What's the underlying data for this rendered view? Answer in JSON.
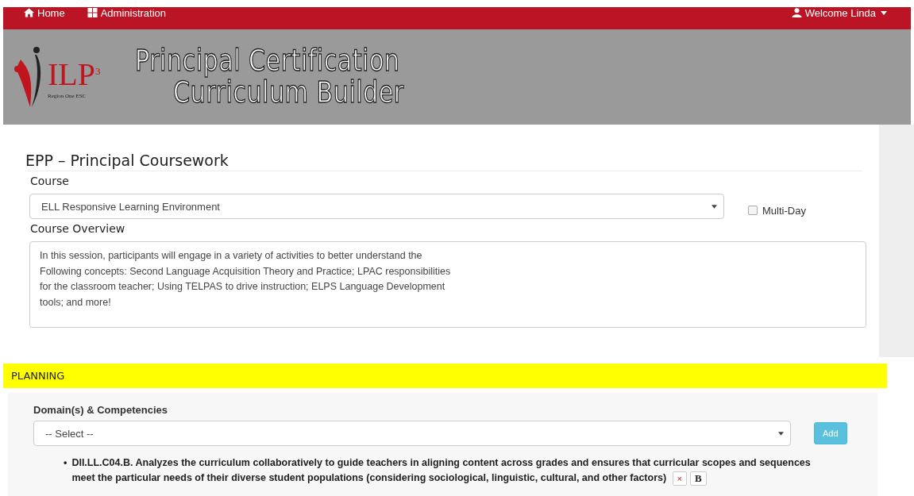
{
  "nav": {
    "items": [
      {
        "label": "Home",
        "kind": "home"
      },
      {
        "label": "Administration",
        "kind": "grid"
      }
    ],
    "user": {
      "label": "Welcome Linda"
    }
  },
  "banner": {
    "logo": {
      "letters": "ILP",
      "superscript": "3",
      "subtitle": "Region One ESC"
    },
    "title_lines": [
      "Principal Certification",
      "Curriculum Builder"
    ]
  },
  "form": {
    "title": "EPP – Principal Coursework",
    "course": {
      "label": "Course",
      "value": "ELL Responsive Learning Environment"
    },
    "multi_day": {
      "label": "Multi-Day",
      "checked": false
    },
    "overview": {
      "label": "Course Overview",
      "lines": [
        "In this session, participants will engage in a variety of activities to better understand the",
        "Following concepts: Second Language Acquisition Theory and Practice; LPAC responsibilities",
        "for the classroom teacher; Using TELPAS to drive instruction; ELPS Language Development",
        "tools; and more!"
      ]
    }
  },
  "section": {
    "title": "PLANNING"
  },
  "planning": {
    "label": "Domain(s) & Competencies",
    "select": {
      "value": "-- Select --"
    },
    "add_button": "Add",
    "competencies": [
      {
        "bullet": "•",
        "text": "DII.LL.C04.B. Analyzes the curriculum collaboratively to guide teachers in aligning content across grades and ensures that curricular scopes and sequences meet the particular needs of their diverse student populations (considering sociological, linguistic, cultural, and other factors)",
        "remove": "×",
        "bold": "B"
      }
    ]
  }
}
